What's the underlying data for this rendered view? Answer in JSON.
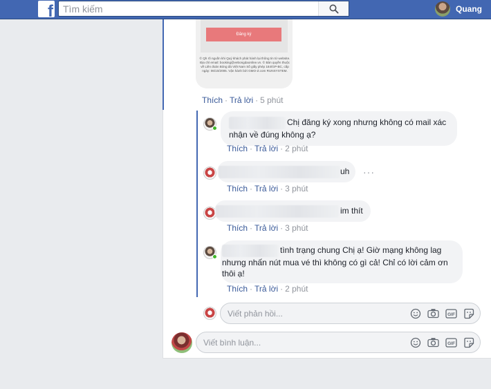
{
  "topbar": {
    "logo": "f",
    "search_placeholder": "Tìm kiếm",
    "user_name": "Quang"
  },
  "attachment": {
    "button_label": "Đăng ký",
    "footer_text": "© Qh rõ nguồn khi Quý khách phát hành lại thông tin từ website. Địa chỉ email: booking@vebongdaonline.vn. © Bản quyền thuộc về Liên đoàn Bóng đá Việt Nam Số giấy phép 184/GP-BC, cấp ngày: 06/10/2005. Vận hành bởi GMO-Z.com RUNSYSTEM."
  },
  "main_comment_actions": {
    "like": "Thích",
    "reply": "Trả lời",
    "time": "5 phút"
  },
  "replies": [
    {
      "text": "Chị đăng ký xong nhưng không có mail xác nhận về đúng không ạ?",
      "like": "Thích",
      "reply": "Trả lời",
      "time": "2 phút",
      "online": true
    },
    {
      "text": "uh",
      "like": "Thích",
      "reply": "Trả lời",
      "time": "3 phút",
      "online": false
    },
    {
      "text": "im thít",
      "like": "Thích",
      "reply": "Trả lời",
      "time": "3 phút",
      "online": false
    },
    {
      "text": "tình trạng chung Chị ạ! Giờ mạng không lag nhưng nhấn nút mua vé thì không có gì cả! Chỉ có lời cảm ơn thôi ạ!",
      "like": "Thích",
      "reply": "Trả lời",
      "time": "2 phút",
      "online": true
    }
  ],
  "more_options": "···",
  "reply_input": {
    "placeholder": "Viết phản hồi..."
  },
  "comment_input": {
    "placeholder": "Viết bình luận..."
  },
  "icons": [
    "search-icon",
    "emoji-icon",
    "camera-icon",
    "gif-icon",
    "sticker-icon"
  ],
  "colors": {
    "brand": "#4267b2",
    "link": "#385898",
    "online": "#42b72a"
  }
}
